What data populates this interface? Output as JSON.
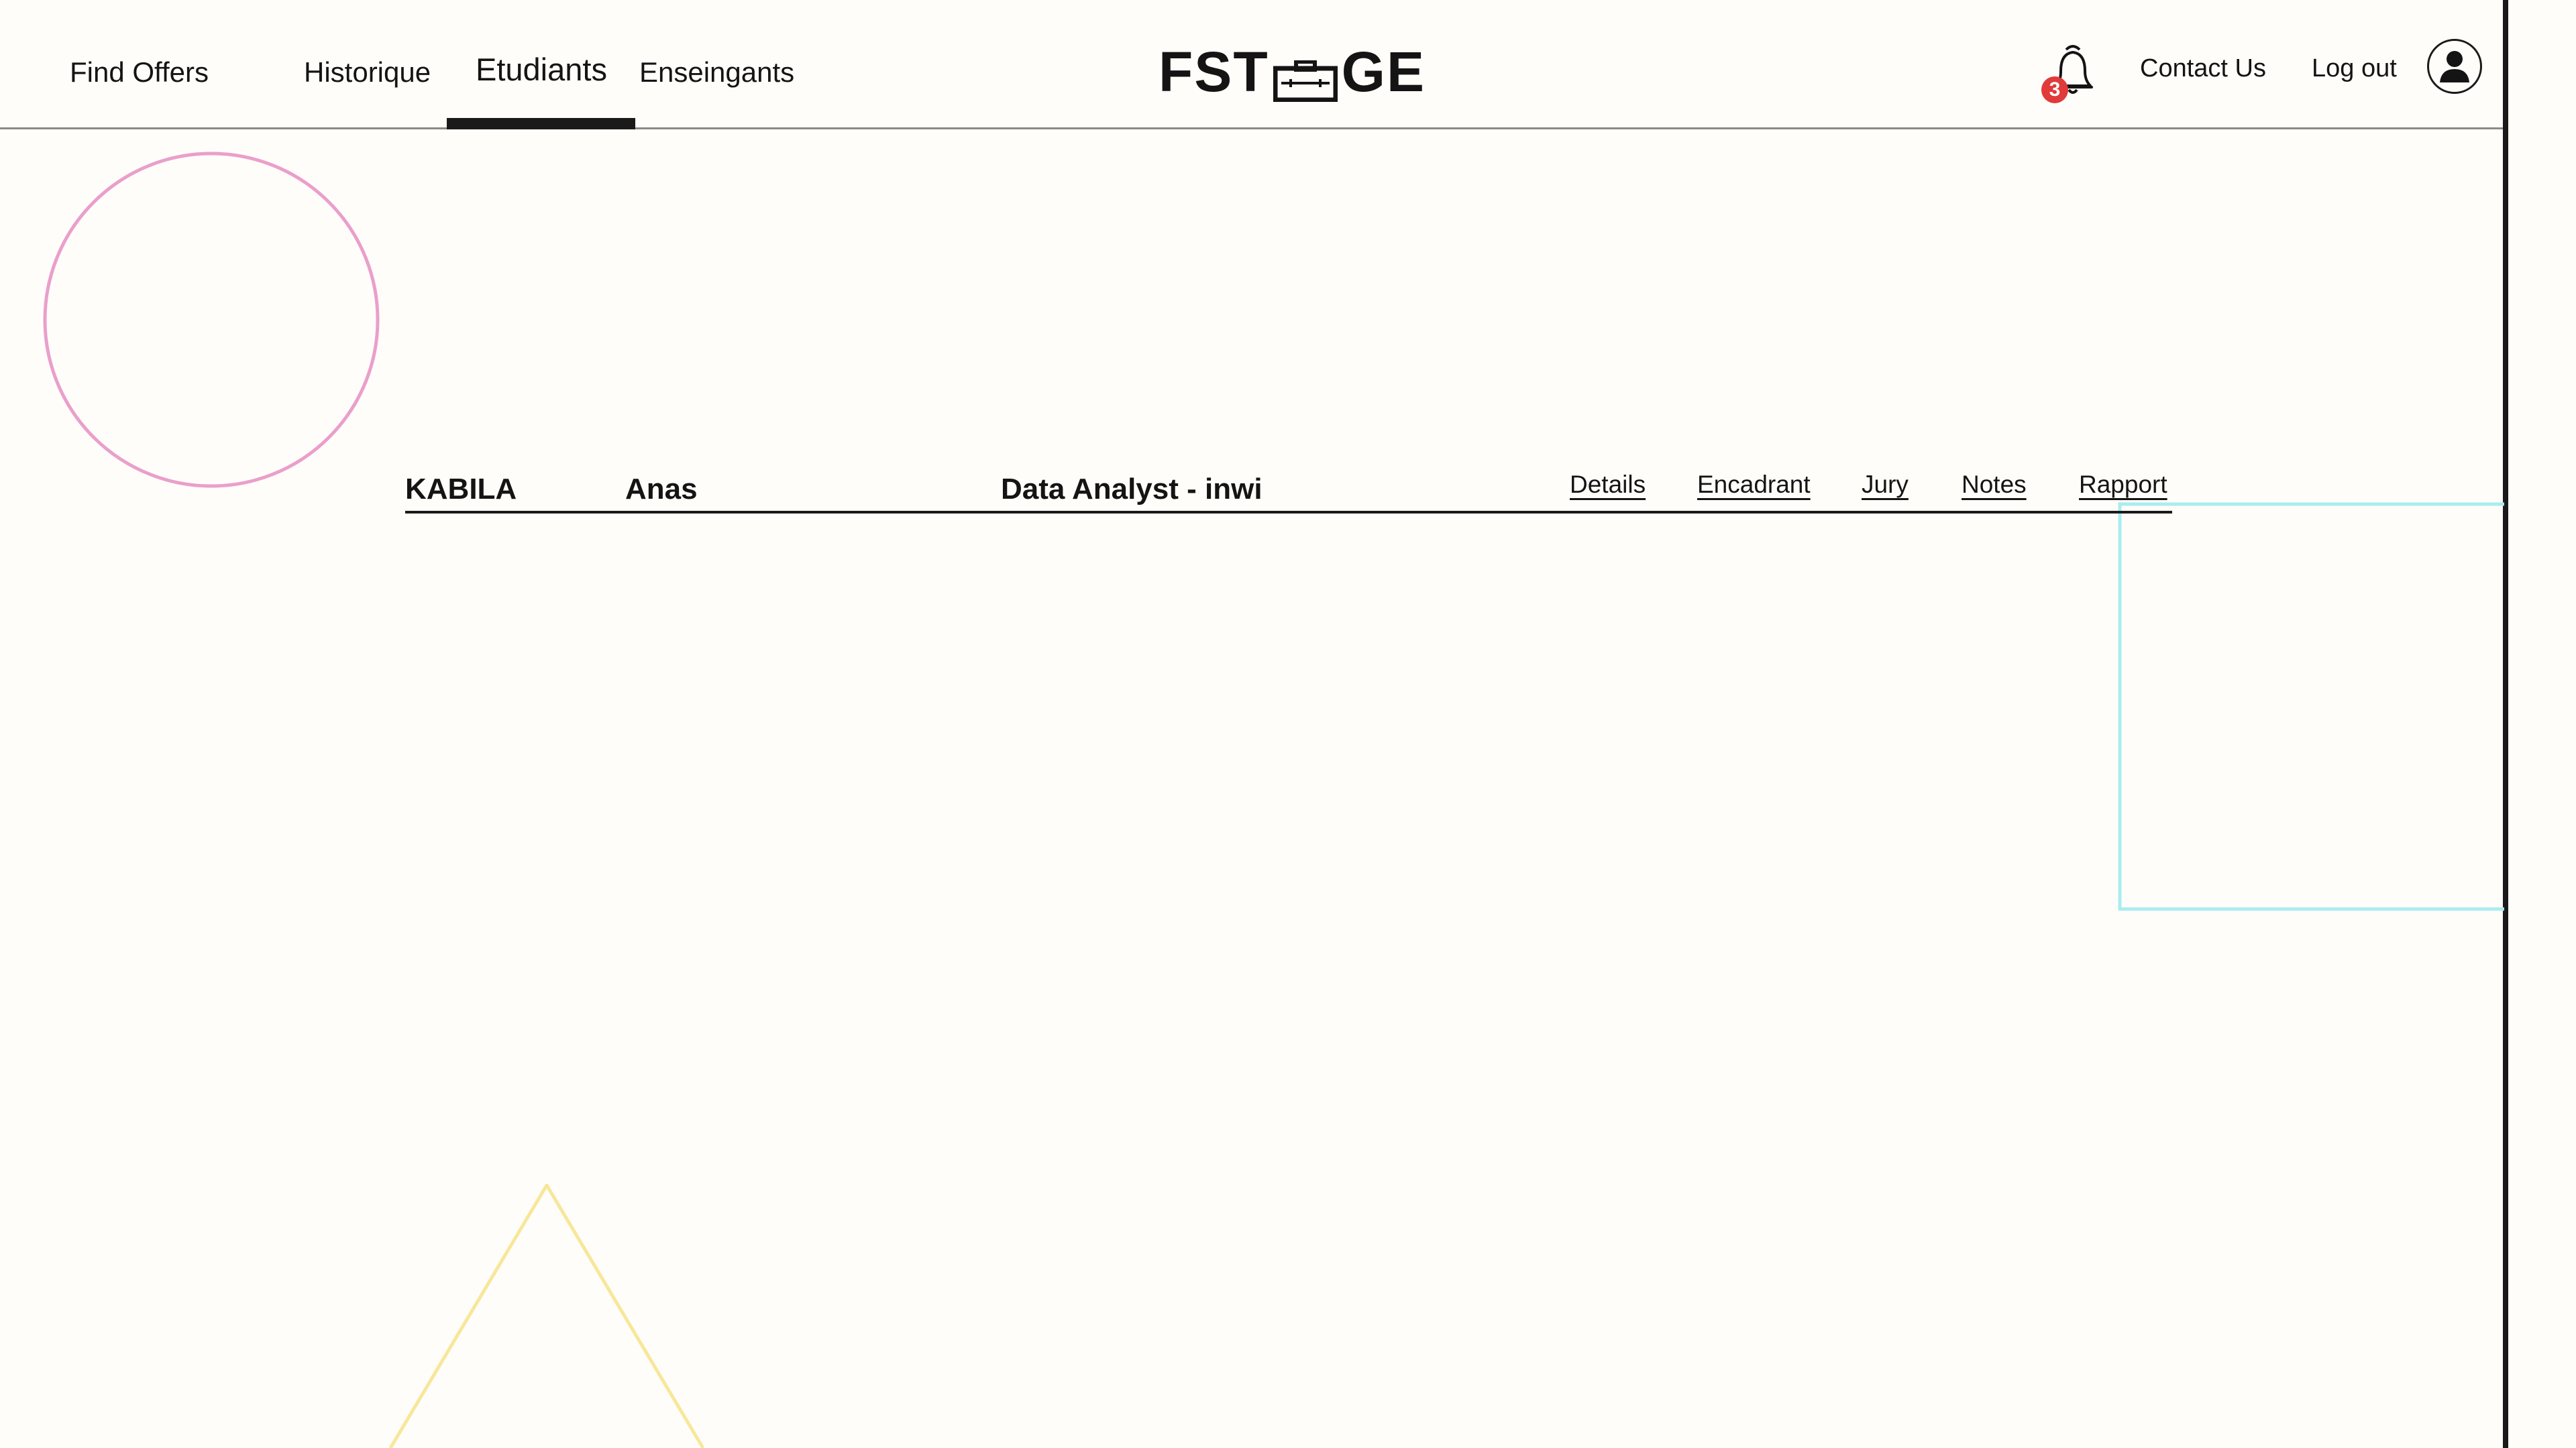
{
  "nav": {
    "items": [
      {
        "label": "Find Offers"
      },
      {
        "label": "Historique"
      },
      {
        "label": "Etudiants",
        "active": true
      },
      {
        "label": "Enseingants"
      }
    ]
  },
  "logo": {
    "left": "FST",
    "right": "GE",
    "icon": "briefcase-icon"
  },
  "notifications": {
    "count": "3",
    "icon": "bell-icon"
  },
  "header_links": {
    "contact": "Contact Us",
    "logout": "Log out"
  },
  "profile": {
    "icon": "user-icon"
  },
  "students": [
    {
      "last_name": "KABILA",
      "first_name": "Anas",
      "position": "Data Analyst - inwi",
      "actions": [
        "Details",
        "Encadrant",
        "Jury",
        "Notes",
        "Rapport"
      ]
    }
  ],
  "colors": {
    "background": "#fffdf9",
    "text": "#141414",
    "badge": "#e03a3a",
    "circle": "#ea9fcb",
    "rectangle": "#a9ecf0",
    "triangle": "#f7e79a"
  }
}
